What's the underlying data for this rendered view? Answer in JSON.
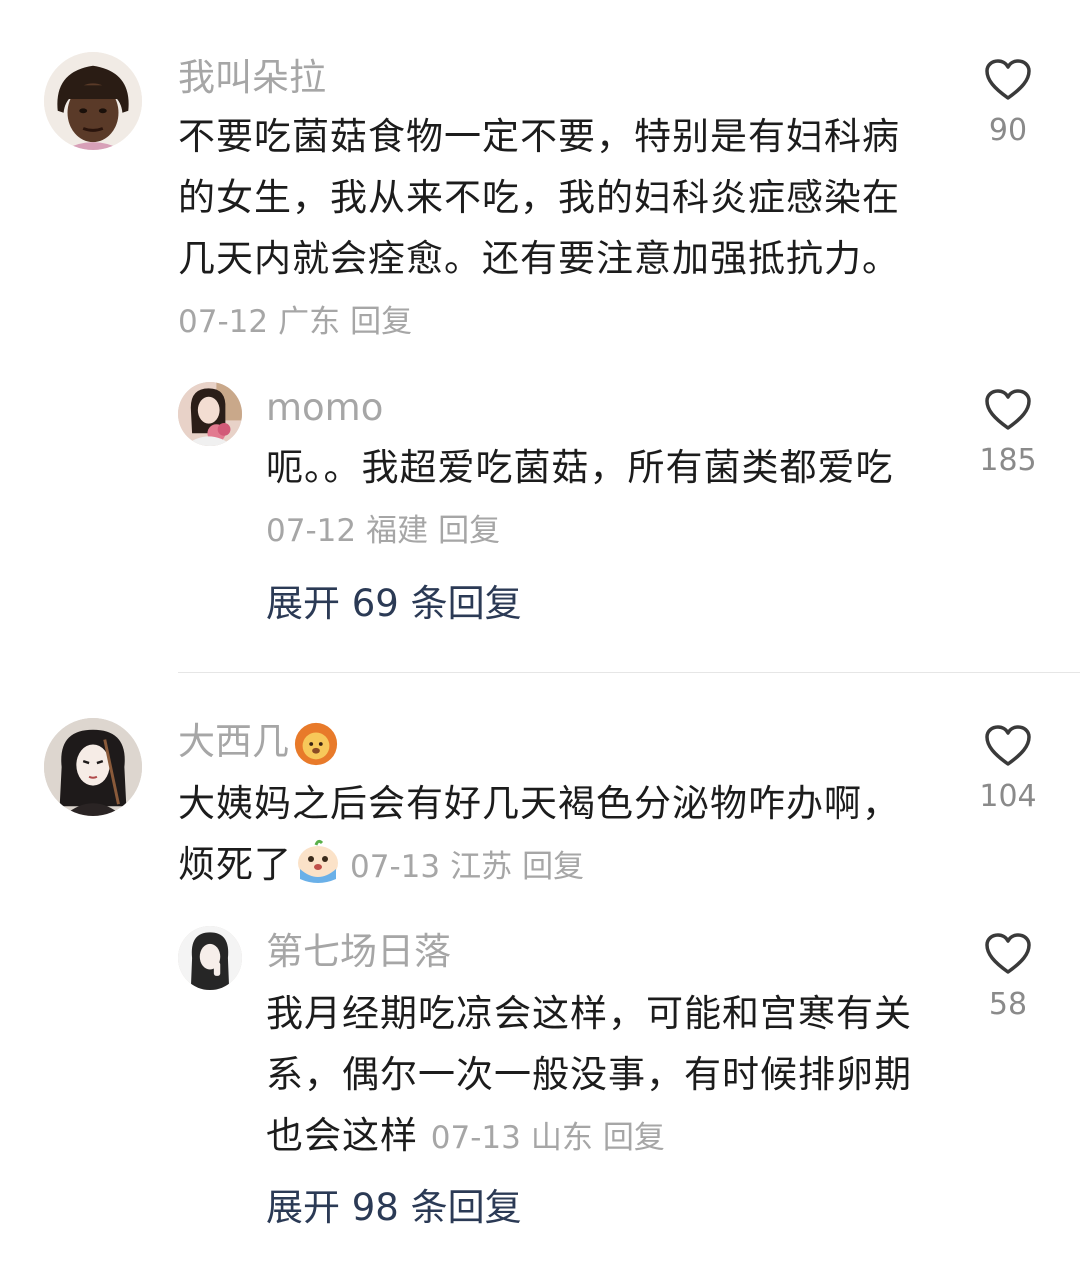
{
  "comments": [
    {
      "username": "我叫朵拉",
      "lines": [
        "不要吃菌菇食物一定不要，特别是有妇科病",
        "的女生，我从来不吃，我的妇科炎症感染在",
        "几天内就会痊愈。还有要注意加强抵抗力。"
      ],
      "date": "07-12",
      "location": "广东",
      "reply_label": "回复",
      "likes": "90",
      "replies": [
        {
          "username": "momo",
          "lines": [
            "呃。。我超爱吃菌菇，所有菌类都爱吃"
          ],
          "date": "07-12",
          "location": "福建",
          "reply_label": "回复",
          "likes": "185"
        }
      ],
      "expand_label": "展开 69 条回复"
    },
    {
      "username": "大西几",
      "username_badge_icon": "lion-icon",
      "lines": [
        "大姨妈之后会有好几天褐色分泌物咋办啊，",
        "烦死了"
      ],
      "inline_emoji_icon": "crying-face-icon",
      "date": "07-13",
      "location": "江苏",
      "reply_label": "回复",
      "likes": "104",
      "replies": [
        {
          "username": "第七场日落",
          "lines": [
            "我月经期吃凉会这样，可能和宫寒有关",
            "系，偶尔一次一般没事，有时候排卵期",
            "也会这样"
          ],
          "date": "07-13",
          "location": "山东",
          "reply_label": "回复",
          "likes": "58"
        }
      ],
      "expand_label": "展开 98 条回复"
    }
  ],
  "colors": {
    "username": "#a6a6a6",
    "text": "#1c1c1c",
    "meta": "#a6a6a6",
    "expand": "#2b3a55",
    "like_count": "#8a8a8a"
  }
}
